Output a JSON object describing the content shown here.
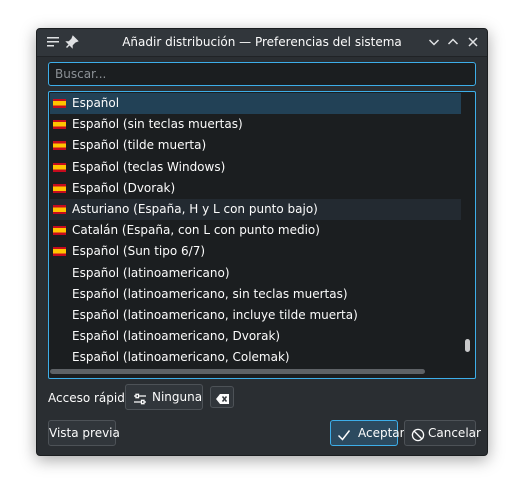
{
  "window": {
    "title": "Añadir distribución — Preferencias del sistema"
  },
  "titlebar": {
    "menu_icon": "window-menu-icon",
    "pin_icon": "pin-icon",
    "buttons": [
      "minimize",
      "maximize",
      "close"
    ]
  },
  "search": {
    "placeholder": "Buscar..."
  },
  "layouts": [
    {
      "label": "Español",
      "flag": true,
      "state": "selected"
    },
    {
      "label": "Español (sin teclas muertas)",
      "flag": true
    },
    {
      "label": "Español (tilde muerta)",
      "flag": true
    },
    {
      "label": "Español (teclas Windows)",
      "flag": true
    },
    {
      "label": "Español (Dvorak)",
      "flag": true
    },
    {
      "label": "Asturiano (España, H y L con punto bajo)",
      "flag": true,
      "state": "hover"
    },
    {
      "label": "Catalán (España, con L con punto medio)",
      "flag": true
    },
    {
      "label": "Español (Sun tipo 6/7)",
      "flag": true
    },
    {
      "label": "Español (latinoamericano)",
      "flag": false
    },
    {
      "label": "Español (latinoamericano, sin teclas muertas)",
      "flag": false
    },
    {
      "label": "Español (latinoamericano, incluye tilde muerta)",
      "flag": false
    },
    {
      "label": "Español (latinoamericano, Dvorak)",
      "flag": false
    },
    {
      "label": "Español (latinoamericano, Colemak)",
      "flag": false
    }
  ],
  "scroll": {
    "vertical_position": 0.95,
    "horizontal_position": 0.0
  },
  "shortcut": {
    "label": "Acceso rápido:",
    "value": "Ninguna",
    "value_icon": "configure-icon",
    "clear_icon": "clear-backspace-icon"
  },
  "buttons": {
    "preview": "Vista previa",
    "accept": "Aceptar",
    "accept_icon": "checkmark-icon",
    "cancel": "Cancelar",
    "cancel_icon": "cancel-icon"
  },
  "colors": {
    "accent": "#3daee9",
    "window_bg": "#2a2e32",
    "selection": "#224156"
  }
}
